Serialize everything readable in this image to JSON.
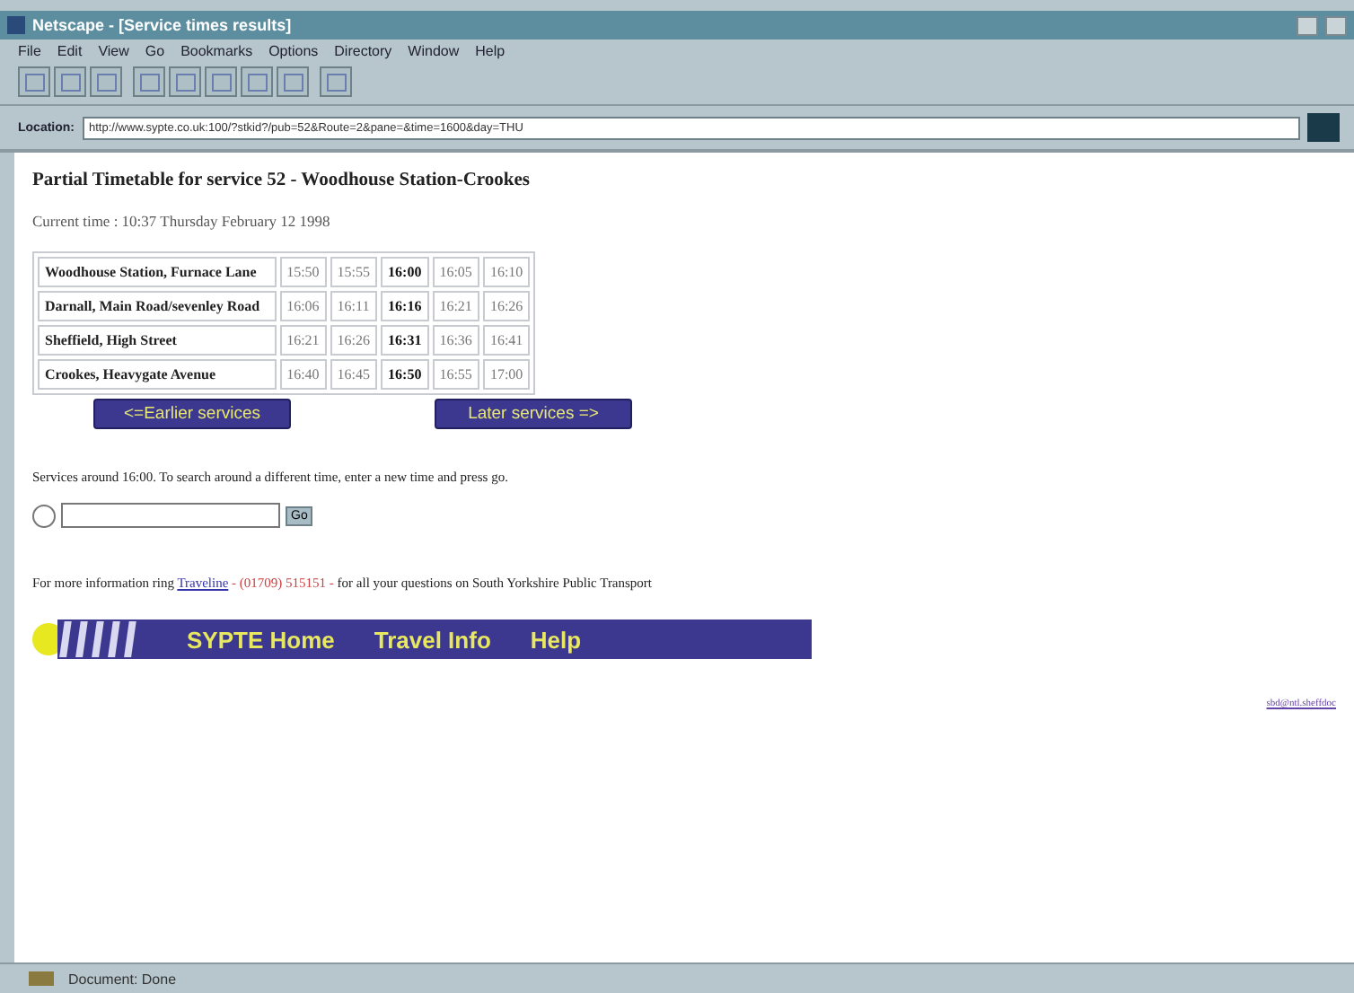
{
  "window": {
    "title": "Netscape - [Service times results]"
  },
  "menu": [
    "File",
    "Edit",
    "View",
    "Go",
    "Bookmarks",
    "Options",
    "Directory",
    "Window",
    "Help"
  ],
  "location": {
    "label": "Location:",
    "value": "http://www.sypte.co.uk:100/?stkid?/pub=52&Route=2&pane=&time=1600&day=THU"
  },
  "page": {
    "heading": "Partial Timetable for service 52 - Woodhouse Station-Crookes",
    "current_time": "Current time : 10:37 Thursday February 12 1998",
    "timetable": {
      "rows": [
        {
          "stop": "Woodhouse Station, Furnace Lane",
          "times": [
            {
              "time": "15:50",
              "highlighted": false
            },
            {
              "time": "15:55",
              "highlighted": false
            },
            {
              "time": "16:00",
              "highlighted": true
            },
            {
              "time": "16:05",
              "highlighted": false
            },
            {
              "time": "16:10",
              "highlighted": false
            }
          ]
        },
        {
          "stop": "Darnall, Main Road/sevenley Road",
          "times": [
            {
              "time": "16:06",
              "highlighted": false
            },
            {
              "time": "16:11",
              "highlighted": false
            },
            {
              "time": "16:16",
              "highlighted": true
            },
            {
              "time": "16:21",
              "highlighted": false
            },
            {
              "time": "16:26",
              "highlighted": false
            }
          ]
        },
        {
          "stop": "Sheffield, High Street",
          "times": [
            {
              "time": "16:21",
              "highlighted": false
            },
            {
              "time": "16:26",
              "highlighted": false
            },
            {
              "time": "16:31",
              "highlighted": true
            },
            {
              "time": "16:36",
              "highlighted": false
            },
            {
              "time": "16:41",
              "highlighted": false
            }
          ]
        },
        {
          "stop": "Crookes, Heavygate Avenue",
          "times": [
            {
              "time": "16:40",
              "highlighted": false
            },
            {
              "time": "16:45",
              "highlighted": false
            },
            {
              "time": "16:50",
              "highlighted": true
            },
            {
              "time": "16:55",
              "highlighted": false
            },
            {
              "time": "17:00",
              "highlighted": false
            }
          ]
        }
      ]
    },
    "earlier_button": "<=Earlier services",
    "later_button": "Later services =>",
    "search_note": "Services around 16:00. To search around a different time, enter a new time and press go.",
    "go_button": "Go",
    "info": {
      "before": "For more information ring ",
      "link": "Traveline",
      "phone": " - (01709) 515151 - ",
      "after": "for all your questions on South Yorkshire Public Transport"
    },
    "nav": [
      "SYPTE Home",
      "Travel Info",
      "Help"
    ],
    "footer_link": "sbd@ntl.sheffdoc"
  },
  "status_bar": {
    "text": "Document: Done"
  }
}
